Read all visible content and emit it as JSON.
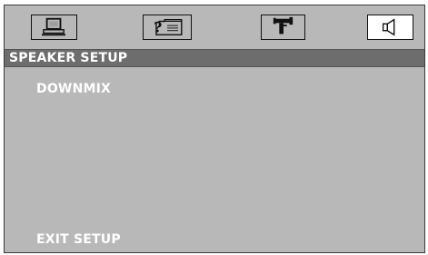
{
  "tabs": [
    {
      "icon": "monitor-icon",
      "active": false
    },
    {
      "icon": "question-document-icon",
      "active": false
    },
    {
      "icon": "camera-icon",
      "active": false
    },
    {
      "icon": "speaker-icon",
      "active": true
    }
  ],
  "header": {
    "title": "SPEAKER SETUP"
  },
  "menu": {
    "items": [
      "DOWNMIX",
      "EXIT SETUP"
    ]
  },
  "colors": {
    "panel": "#b8b8b8",
    "title_bar": "#6d6d6d",
    "active_tab": "#ffffff",
    "text": "#ffffff"
  }
}
